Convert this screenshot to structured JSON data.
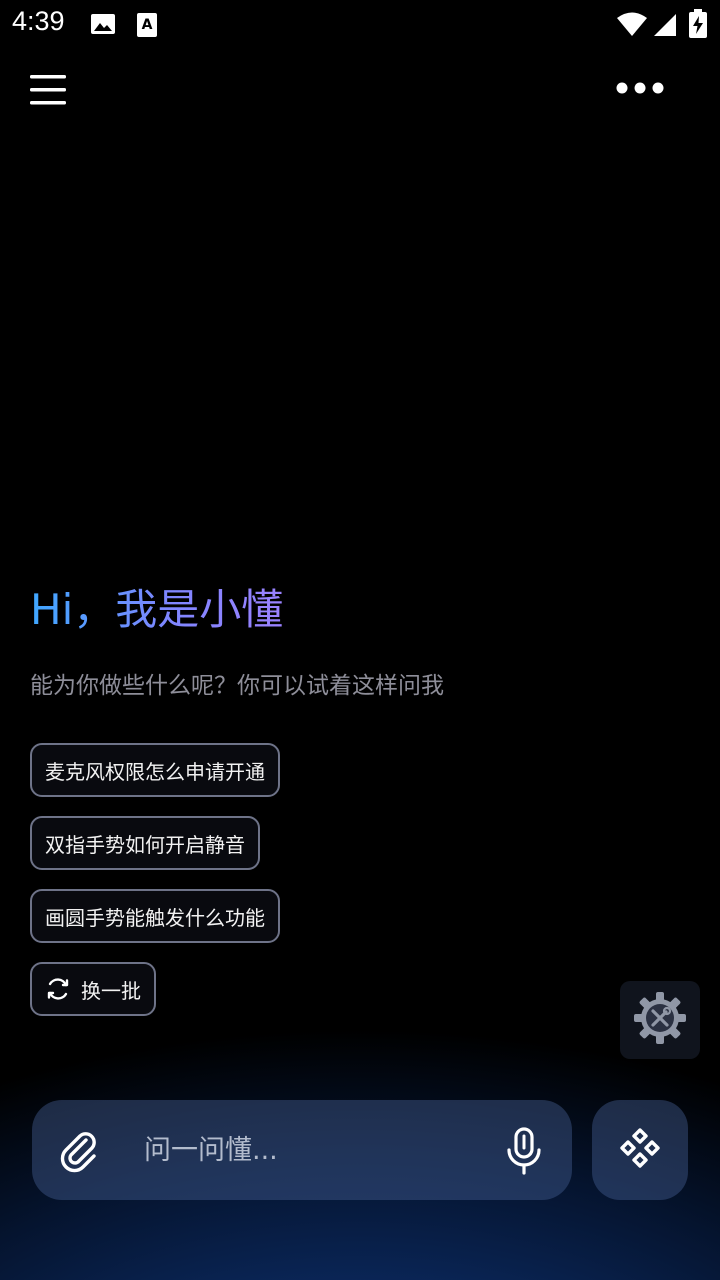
{
  "status_bar": {
    "time": "4:39",
    "icons": [
      "image-icon",
      "text-a-icon",
      "wifi-icon",
      "signal-icon",
      "battery-charging-icon"
    ]
  },
  "top_bar": {
    "menu_icon": "hamburger-menu-icon",
    "more_icon": "more-dots-icon"
  },
  "greeting": {
    "title": "Hi，我是小懂",
    "subtitle": "能为你做些什么呢？你可以试着这样问我"
  },
  "suggestions": [
    "麦克风权限怎么申请开通",
    "双指手势如何开启静音",
    "画圆手势能触发什么功能"
  ],
  "refresh": {
    "label": "换一批",
    "icon": "refresh-icon"
  },
  "tool_button": {
    "icon": "settings-tools-icon"
  },
  "input": {
    "placeholder": "问一问懂...",
    "value": "",
    "attach_icon": "paperclip-icon",
    "mic_icon": "microphone-icon"
  },
  "feature_button": {
    "icon": "diamond-grid-icon"
  },
  "colors": {
    "greeting_gradient_start": "#3fa7ff",
    "greeting_gradient_end": "#9b82ff",
    "chip_border": "#6e7388",
    "subtitle": "#8e8e99"
  }
}
